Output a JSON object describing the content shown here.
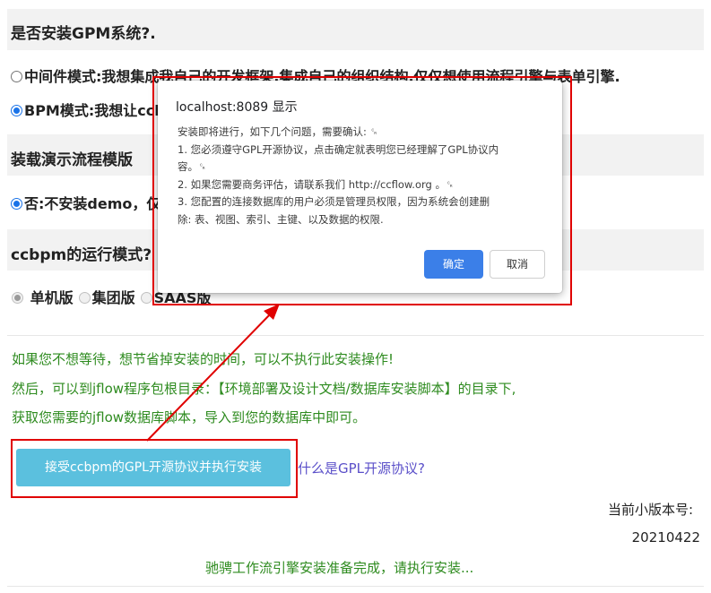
{
  "sections": {
    "gpm_title": "是否安装GPM系统?.",
    "gpm_opt_middleware": "中间件模式:我想集成我自己的开发框架,集成自己的组织结构,仅仅想使用流程引擎与表单引擎.",
    "gpm_opt_bpm": "BPM模式:我想让ccbpm",
    "demo_title": "装载演示流程模版",
    "demo_opt_no": "否:不安装demo，仅",
    "run_mode_title": "ccbpm的运行模式?",
    "run_mode_options": [
      "单机版",
      "集团版",
      "SAAS版"
    ]
  },
  "notice": {
    "line1": "如果您不想等待，想节省掉安装的时间，可以不执行此安装操作!",
    "line2": "然后，可以到jflow程序包根目录：【环境部署及设计文档/数据库安装脚本】的目录下,",
    "line3": "获取您需要的jflow数据库脚本，导入到您的数据库中即可。"
  },
  "actions": {
    "install_button": "接受ccbpm的GPL开源协议并执行安装",
    "gpl_link": "什么是GPL开源协议?"
  },
  "version": {
    "label": "当前小版本号:",
    "value": "20210422"
  },
  "footer": {
    "message": "驰骋工作流引擎安装准备完成，请执行安装..."
  },
  "dialog": {
    "title": "localhost:8089 显示",
    "lines": [
      "安装即将进行，如下几个问题，需要确认: ␍",
      "1. 您必须遵守GPL开源协议，点击确定就表明您已经理解了GPL协议内",
      "容。␍",
      "2. 如果您需要商务评估，请联系我们 http://ccflow.org 。␍",
      "3. 您配置的连接数据库的用户必须是管理员权限，因为系统会创建删",
      "除: 表、视图、索引、主键、以及数据的权限."
    ],
    "ok": "确定",
    "cancel": "取消"
  },
  "colors": {
    "annotation_red": "#e00000",
    "notice_green": "#2e8b1f",
    "install_button": "#5bc0de",
    "dialog_ok": "#3b7fe8",
    "link": "#5b50c9"
  }
}
